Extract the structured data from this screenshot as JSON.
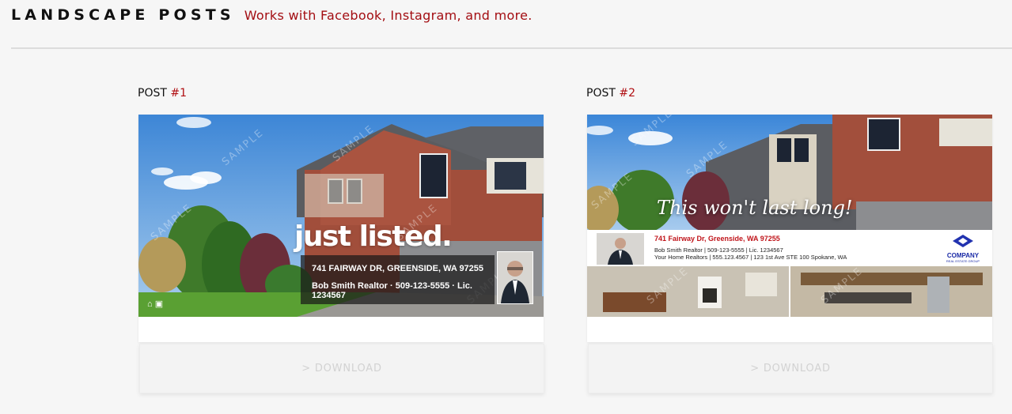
{
  "header": {
    "title": "LANDSCAPE POSTS",
    "subtitle": "Works with Facebook, Instagram, and more."
  },
  "posts": [
    {
      "label": "POST",
      "number": "#1",
      "headline": "just listed.",
      "address": "741 FAIRWAY DR, GREENSIDE, WA 97255",
      "contact": "Bob Smith Realtor  ·  509-123-5555  ·  Lic. 1234567",
      "download": "> DOWNLOAD"
    },
    {
      "label": "POST",
      "number": "#2",
      "headline": "This won't last long!",
      "address": "741 Fairway Dr, Greenside, WA 97255",
      "line1": "Bob Smith Realtor | 509-123-5555 | Lic. 1234567",
      "line2": "Your Home Realtors | 555.123.4567 | 123 1st Ave STE 100 Spokane, WA",
      "logo": "COMPANY",
      "logo_sub": "REAL ESTATE GROUP",
      "download": "> DOWNLOAD"
    }
  ]
}
